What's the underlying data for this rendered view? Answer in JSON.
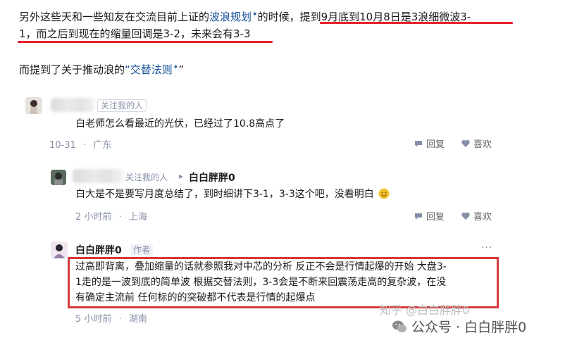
{
  "article": {
    "line1_a": "另外这些天和一些知友在交流目前上证的",
    "line1_link": "波浪规划",
    "line1_b": "的时候，",
    "line1_c": "提到9月底到10月8日是3浪细微波3-",
    "line2": "1，而之后到现在的缩量回调是3-2，未来会有3-3",
    "line3_a": "而提到了关于推动浪的",
    "line3_link": "“交替法则",
    "line3_b": "”"
  },
  "comments": [
    {
      "follow_tag": "关注我的人",
      "text": "白老师怎么看最近的光伏，已经过了10.8高点了",
      "date": "10-31",
      "location": "广东",
      "reply_label": "回复",
      "like_label": "喜欢"
    },
    {
      "follow_tag": "关注我的人",
      "arrow": "▸",
      "reply_to": "白白胖胖0",
      "text": "白大是不是要写月度总结了，到时细讲下3-1，3-3这个吧，没看明白",
      "emoji": "smile-emoji",
      "date": "2 小时前",
      "location": "上海",
      "reply_label": "回复",
      "like_label": "喜欢"
    },
    {
      "author": "白白胖胖0",
      "author_tag": "作者",
      "text_lines": [
        "过高即背离，叠加缩量的话就参照我对中芯的分析 反正不会是行情起爆的开始 大盘3-",
        "1走的是一波到底的简单波 根据交替法则，3-3会是不断来回震荡走高的复杂波，在没",
        "有确定主流前 任何标的的突破都不代表是行情的起爆点"
      ],
      "date": "5 小时前",
      "location": "湖南"
    }
  ],
  "menu_dots": "···",
  "watermark": {
    "zhihu": "知乎 @白白胖胖0",
    "wechat": "公众号 · 白白胖胖0"
  },
  "colors": {
    "link": "#175199",
    "underline_red": "#e8202f",
    "box_red": "#d63a3a",
    "meta_gray": "#8590a6"
  }
}
